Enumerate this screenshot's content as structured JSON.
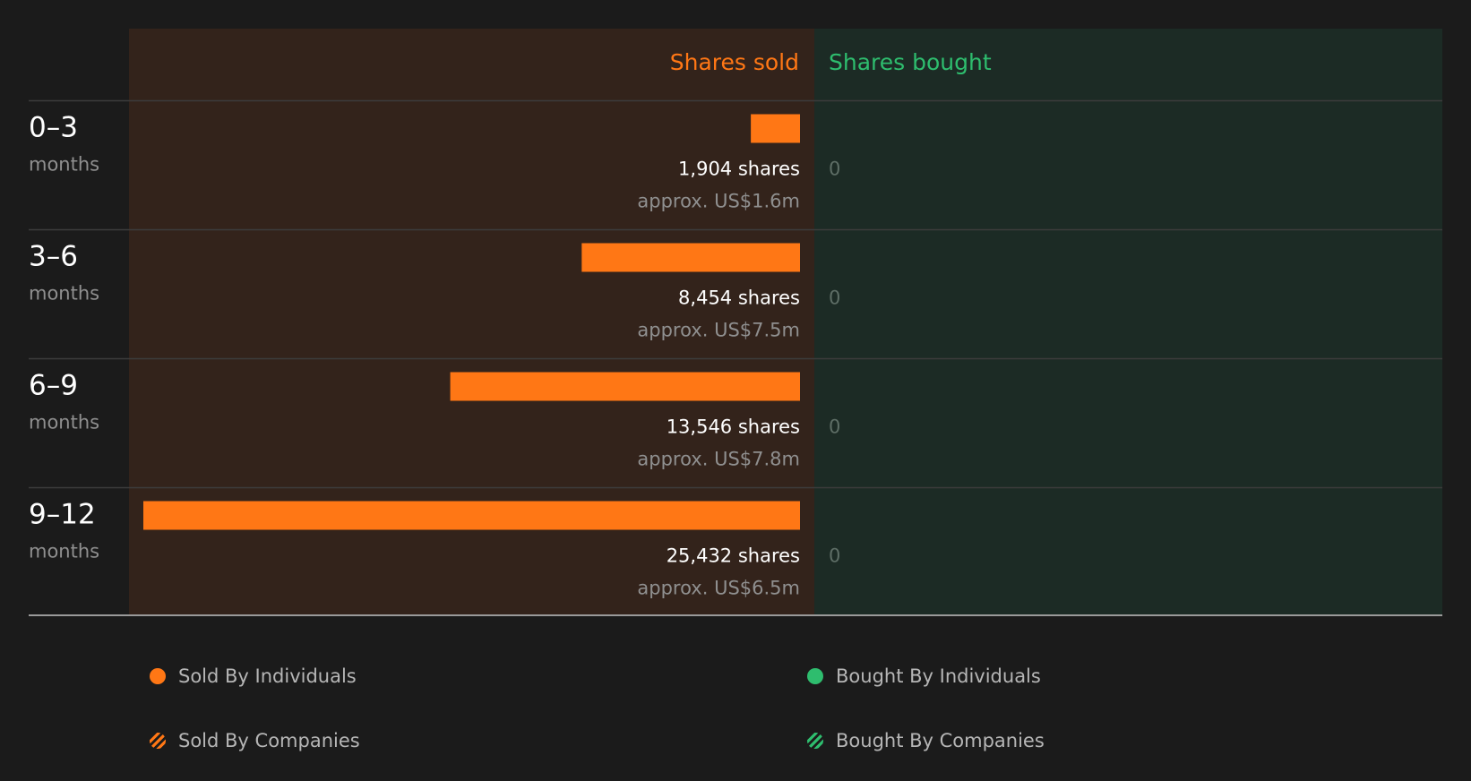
{
  "chart_data": {
    "type": "bar",
    "headers": {
      "sold": "Shares sold",
      "bought": "Shares bought"
    },
    "categories": [
      {
        "range": "0–3",
        "unit": "months"
      },
      {
        "range": "3–6",
        "unit": "months"
      },
      {
        "range": "6–9",
        "unit": "months"
      },
      {
        "range": "9–12",
        "unit": "months"
      }
    ],
    "series": [
      {
        "name": "Shares sold",
        "values": [
          1904,
          8454,
          13546,
          25432
        ],
        "share_labels": [
          "1,904 shares",
          "8,454 shares",
          "13,546 shares",
          "25,432 shares"
        ],
        "value_labels": [
          "approx. US$1.6m",
          "approx. US$7.5m",
          "approx. US$7.8m",
          "approx. US$6.5m"
        ]
      },
      {
        "name": "Shares bought",
        "values": [
          0,
          0,
          0,
          0
        ],
        "share_labels": [
          "0",
          "0",
          "0",
          "0"
        ]
      }
    ],
    "legend": [
      {
        "label": "Sold By Individuals",
        "style": "dot",
        "color": "#ff7715"
      },
      {
        "label": "Bought By Individuals",
        "style": "dot",
        "color": "#2ebd6e"
      },
      {
        "label": "Sold By Companies",
        "style": "hatch",
        "color": "#ff7715"
      },
      {
        "label": "Bought By Companies",
        "style": "hatch",
        "color": "#2ebd6e"
      }
    ],
    "colors": {
      "sold": "#ff7715",
      "bought": "#2ebd6e",
      "sold_panel": "#33231b",
      "bought_panel": "#1c2b25",
      "background": "#1b1b1b"
    }
  }
}
